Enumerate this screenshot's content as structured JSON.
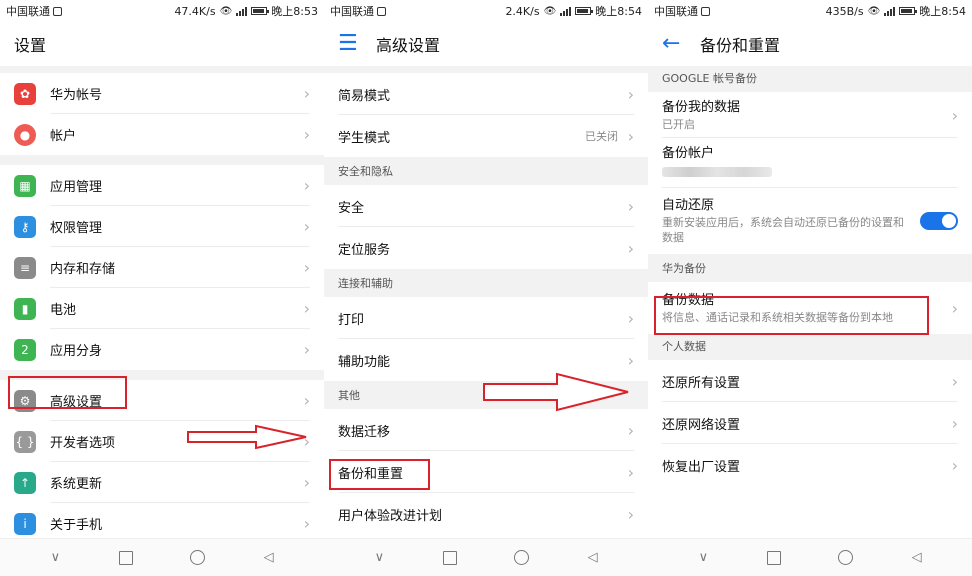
{
  "panel1": {
    "status": {
      "carrier": "中国联通",
      "speed": "47.4K/s",
      "net": "4G",
      "time": "晚上8:53"
    },
    "title": "设置",
    "group1": [
      {
        "label": "华为帐号",
        "icon": "huawei-icon"
      },
      {
        "label": "帐户",
        "icon": "account-icon"
      }
    ],
    "group2": [
      {
        "label": "应用管理",
        "icon": "apps-icon"
      },
      {
        "label": "权限管理",
        "icon": "key-icon"
      },
      {
        "label": "内存和存储",
        "icon": "storage-icon"
      },
      {
        "label": "电池",
        "icon": "battery-icon"
      },
      {
        "label": "应用分身",
        "icon": "app-twin-icon"
      }
    ],
    "group3": [
      {
        "label": "高级设置",
        "icon": "gear-icon"
      },
      {
        "label": "开发者选项",
        "icon": "braces-icon"
      },
      {
        "label": "系统更新",
        "icon": "update-icon"
      },
      {
        "label": "关于手机",
        "icon": "info-icon"
      }
    ]
  },
  "panel2": {
    "status": {
      "carrier": "中国联通",
      "speed": "2.4K/s",
      "net": "4G",
      "time": "晚上8:54"
    },
    "title": "高级设置",
    "rows_top": [
      {
        "label": "简易模式"
      },
      {
        "label": "学生模式",
        "value": "已关闭"
      }
    ],
    "section_security": "安全和隐私",
    "rows_security": [
      {
        "label": "安全"
      },
      {
        "label": "定位服务"
      }
    ],
    "section_connect": "连接和辅助",
    "rows_connect": [
      {
        "label": "打印"
      },
      {
        "label": "辅助功能"
      }
    ],
    "section_other": "其他",
    "rows_other": [
      {
        "label": "数据迁移"
      },
      {
        "label": "备份和重置"
      },
      {
        "label": "用户体验改进计划"
      }
    ]
  },
  "panel3": {
    "status": {
      "carrier": "中国联通",
      "speed": "435B/s",
      "net": "4G",
      "time": "晚上8:54"
    },
    "title": "备份和重置",
    "section_google": "GOOGLE 帐号备份",
    "backup_my_data": {
      "label": "备份我的数据",
      "sub": "已开启"
    },
    "backup_account": {
      "label": "备份帐户"
    },
    "auto_restore": {
      "label": "自动还原",
      "sub": "重新安装应用后，系统会自动还原已备份的设置和数据",
      "on": true
    },
    "section_huawei": "华为备份",
    "backup_data": {
      "label": "备份数据",
      "sub": "将信息、通话记录和系统相关数据等备份到本地"
    },
    "section_personal": "个人数据",
    "rows_personal": [
      {
        "label": "还原所有设置"
      },
      {
        "label": "还原网络设置"
      },
      {
        "label": "恢复出厂设置"
      }
    ]
  },
  "colors": {
    "accent": "#1a73e8",
    "highlight": "#d8232a"
  }
}
